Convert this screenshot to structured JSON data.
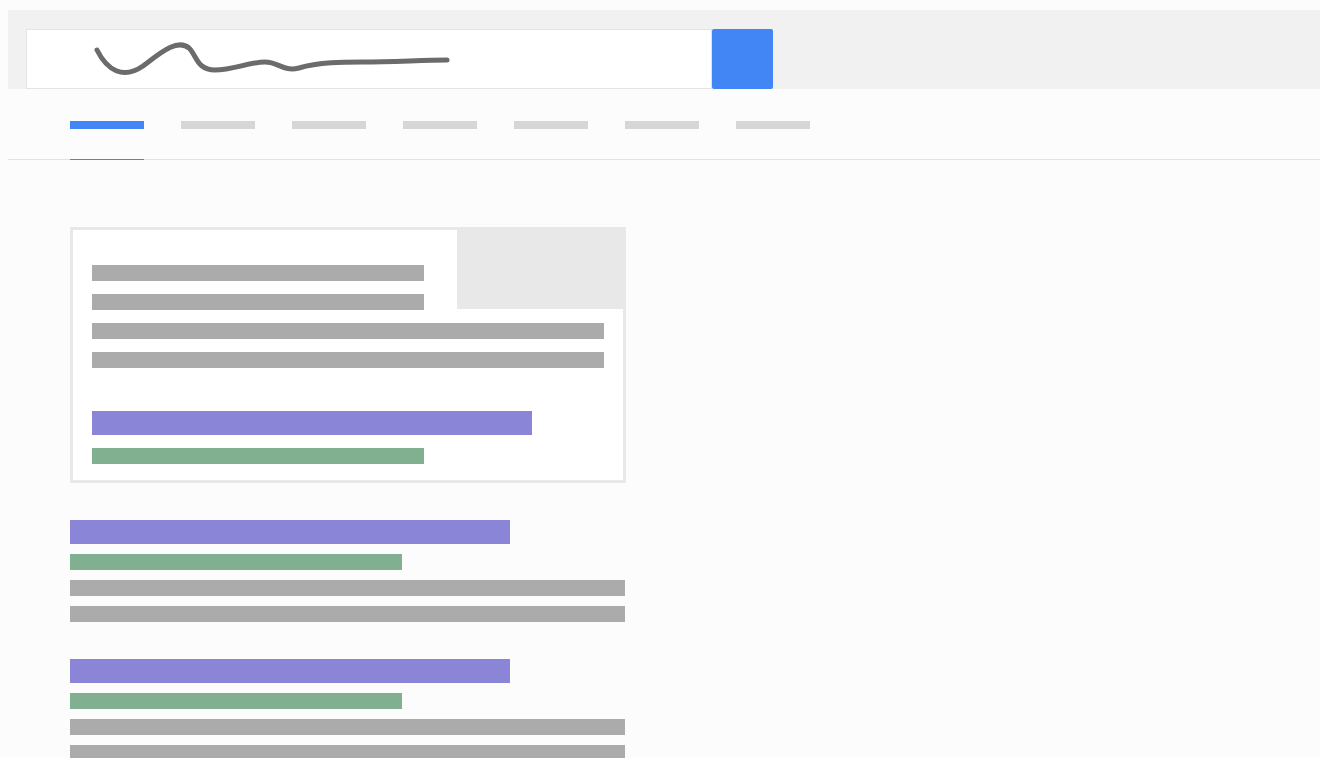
{
  "search": {
    "query": {
      "kind": "scribble"
    }
  },
  "tabs": [
    {
      "selected": true
    },
    {
      "selected": false
    },
    {
      "selected": false
    },
    {
      "selected": false
    },
    {
      "selected": false
    },
    {
      "selected": false
    },
    {
      "selected": false
    }
  ],
  "results": [
    {
      "kind": "featured",
      "image": true,
      "lines": [
        {
          "kind": "text-short"
        },
        {
          "kind": "text-short"
        },
        {
          "kind": "text"
        },
        {
          "kind": "text"
        },
        {
          "kind": "gap"
        },
        {
          "kind": "title"
        },
        {
          "kind": "url"
        }
      ]
    },
    {
      "kind": "plain",
      "image": false,
      "lines": [
        {
          "kind": "title"
        },
        {
          "kind": "url"
        },
        {
          "kind": "text"
        },
        {
          "kind": "text"
        }
      ]
    },
    {
      "kind": "plain",
      "image": false,
      "lines": [
        {
          "kind": "title"
        },
        {
          "kind": "url"
        },
        {
          "kind": "text"
        },
        {
          "kind": "text"
        }
      ]
    }
  ]
}
